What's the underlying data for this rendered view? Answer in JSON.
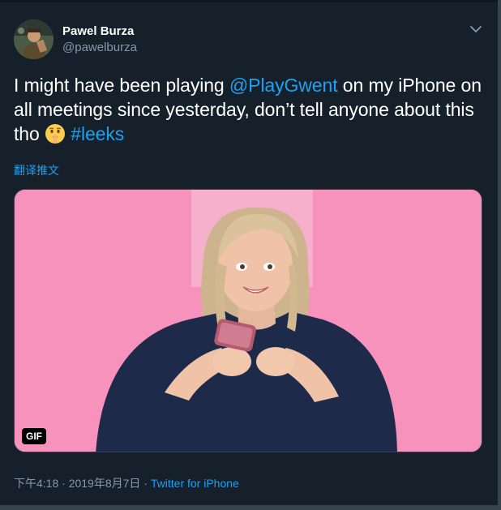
{
  "author": {
    "name": "Pawel Burza",
    "handle": "@pawelburza"
  },
  "tweet": {
    "text_part1": "I might have been playing ",
    "mention": "@PlayGwent",
    "text_part2": " on my iPhone on all meetings since yesterday, don’t tell anyone about this tho ",
    "emoji_icon": "shushing-face-emoji",
    "hashtag": "#leeks"
  },
  "translate_label": "翻译推文",
  "media": {
    "badge": "GIF",
    "background_color": "#f692bc"
  },
  "meta": {
    "time": "下午4:18",
    "separator": " · ",
    "date": "2019年8月7日",
    "source": "Twitter for iPhone"
  },
  "colors": {
    "background": "#15202b",
    "link": "#1da1f2",
    "secondary_text": "#8899a6"
  }
}
